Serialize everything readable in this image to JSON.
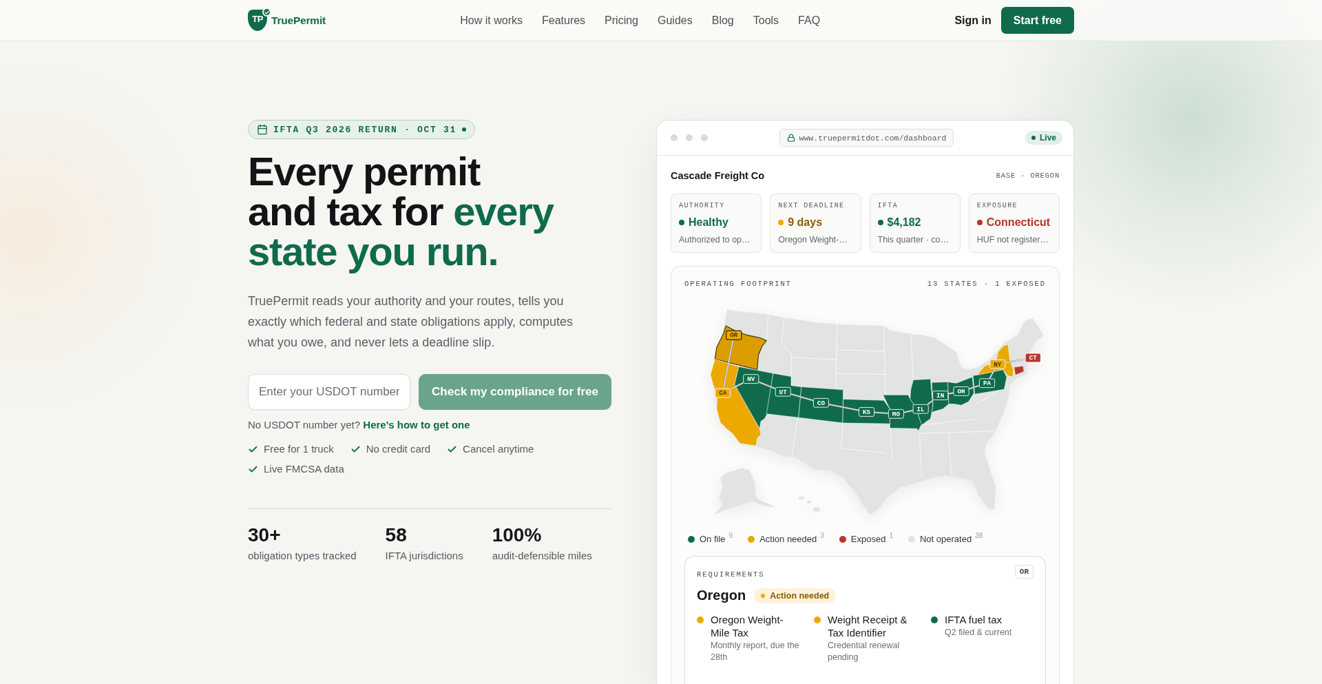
{
  "header": {
    "logo": {
      "mark": "TP",
      "name": "TruePermit"
    },
    "nav": [
      "How it works",
      "Features",
      "Pricing",
      "Guides",
      "Blog",
      "Tools",
      "FAQ"
    ],
    "sign_in": "Sign in",
    "cta": "Start free"
  },
  "hero": {
    "badge": "IFTA Q3 2026 RETURN · OCT 31",
    "headline": [
      [
        {
          "text": "Every permit",
          "accent": false
        }
      ],
      [
        {
          "text": "and tax for ",
          "accent": false
        },
        {
          "text": "every",
          "accent": true
        }
      ],
      [
        {
          "text": "state you run.",
          "accent": true
        }
      ]
    ],
    "lead": "TruePermit reads your authority and your routes, tells you exactly which federal and state obligations apply, computes what you owe, and never lets a deadline slip.",
    "form": {
      "placeholder": "Enter your USDOT number",
      "button": "Check my compliance for free",
      "disabled": true
    },
    "help": {
      "text": "No USDOT number yet?",
      "link": "Here's how to get one"
    },
    "perks": [
      "Free for 1 truck",
      "No credit card",
      "Cancel anytime",
      "Live FMCSA data"
    ],
    "stats": [
      {
        "value": "30+",
        "label": "obligation types tracked"
      },
      {
        "value": "58",
        "label": "IFTA jurisdictions"
      },
      {
        "value": "100%",
        "label": "audit-defensible miles"
      }
    ]
  },
  "dashboard": {
    "url": "www.truepermitdot.com/dashboard",
    "live": "Live",
    "company": "Cascade Freight Co",
    "base": "BASE · OREGON",
    "cards": [
      {
        "label": "AUTHORITY",
        "value": "Healthy",
        "kind": "on_file",
        "note": "Authorized to op…"
      },
      {
        "label": "NEXT DEADLINE",
        "value": "9 days",
        "kind": "action",
        "note": "Oregon Weight-…"
      },
      {
        "label": "IFTA",
        "value": "$4,182",
        "kind": "on_file",
        "note": "This quarter · co…"
      },
      {
        "label": "EXPOSURE",
        "value": "Connecticut",
        "kind": "exposed",
        "note": "HUF not register…"
      }
    ],
    "footprint": {
      "title": "OPERATING FOOTPRINT",
      "summary": "13 STATES · 1 EXPOSED",
      "states": [
        {
          "code": "OR",
          "kind": "action",
          "selected": true
        },
        {
          "code": "CA",
          "kind": "action",
          "selected": false
        },
        {
          "code": "NV",
          "kind": "on_file",
          "selected": false
        },
        {
          "code": "UT",
          "kind": "on_file",
          "selected": false
        },
        {
          "code": "CO",
          "kind": "on_file",
          "selected": false
        },
        {
          "code": "KS",
          "kind": "on_file",
          "selected": false
        },
        {
          "code": "MO",
          "kind": "on_file",
          "selected": false
        },
        {
          "code": "IL",
          "kind": "on_file",
          "selected": false
        },
        {
          "code": "IN",
          "kind": "on_file",
          "selected": false
        },
        {
          "code": "OH",
          "kind": "on_file",
          "selected": false
        },
        {
          "code": "PA",
          "kind": "on_file",
          "selected": false
        },
        {
          "code": "NY",
          "kind": "action",
          "selected": false
        },
        {
          "code": "CT",
          "kind": "exposed",
          "selected": false
        }
      ],
      "legend": [
        {
          "label": "On file",
          "count": "9",
          "kind": "on_file",
          "color": "#0f6b4b"
        },
        {
          "label": "Action needed",
          "count": "3",
          "kind": "action",
          "color": "#eca900"
        },
        {
          "label": "Exposed",
          "count": "1",
          "kind": "exposed",
          "color": "#b7382b"
        },
        {
          "label": "Not operated",
          "count": "38",
          "kind": "not_operated",
          "color": "#e2e4e2"
        }
      ]
    },
    "requirements": {
      "title": "REQUIREMENTS",
      "code": "OR",
      "state": "Oregon",
      "kind": "action",
      "status_label": "Action needed",
      "items": [
        {
          "title": "Oregon Weight-Mile Tax",
          "note": "Monthly report, due the 28th",
          "kind": "action"
        },
        {
          "title": "Weight Receipt & Tax Identifier",
          "note": "Credential renewal pending",
          "kind": "action"
        },
        {
          "title": "IFTA fuel tax",
          "note": "Q2 filed & current",
          "kind": "on_file"
        }
      ]
    }
  }
}
